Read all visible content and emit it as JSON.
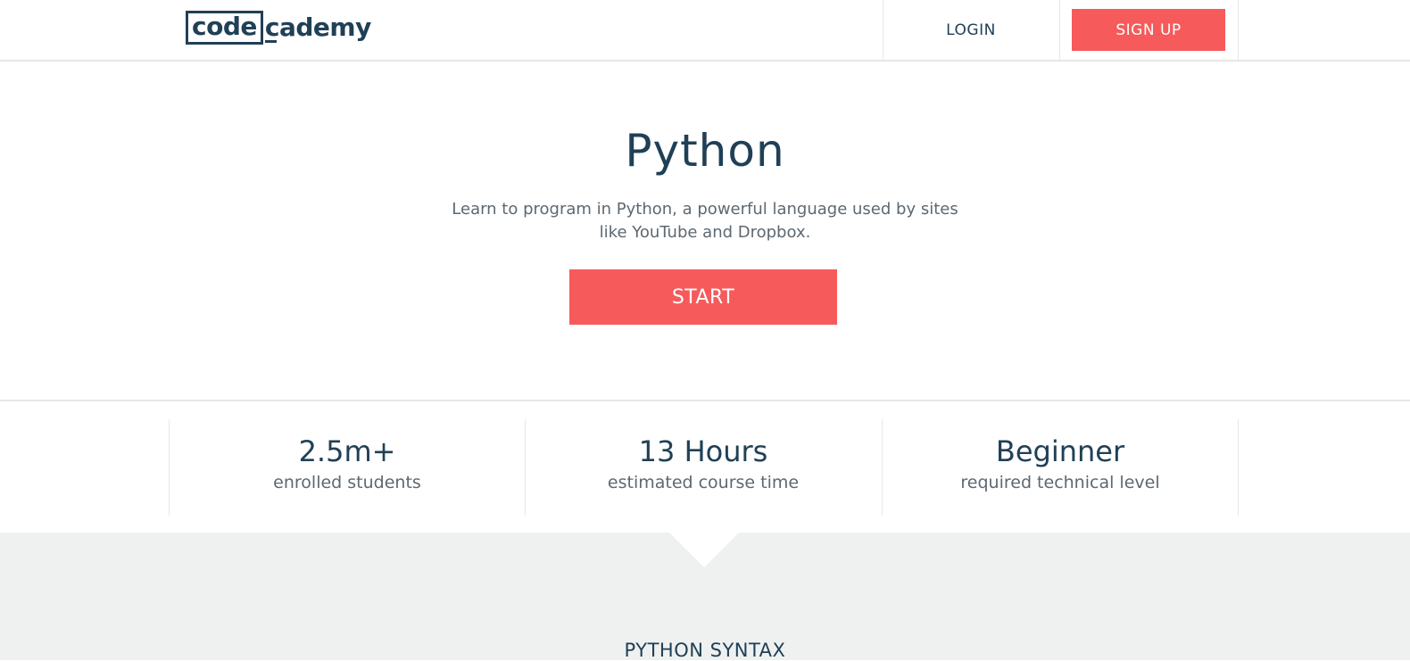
{
  "header": {
    "logo_box": "code",
    "logo_rest": "cademy",
    "login_label": "LOGIN",
    "signup_label": "SIGN UP"
  },
  "hero": {
    "title": "Python",
    "description": "Learn to program in Python, a powerful language used by sites like YouTube and Dropbox.",
    "start_label": "START"
  },
  "stats": [
    {
      "value": "2.5m+",
      "label": "enrolled students"
    },
    {
      "value": "13 Hours",
      "label": "estimated course time"
    },
    {
      "value": "Beginner",
      "label": "required technical level"
    }
  ],
  "next_section": {
    "title": "PYTHON SYNTAX"
  },
  "colors": {
    "accent": "#f65a5b",
    "text_dark": "#204056",
    "text_muted": "#5d6871",
    "gray_bg": "#eff1f0"
  }
}
